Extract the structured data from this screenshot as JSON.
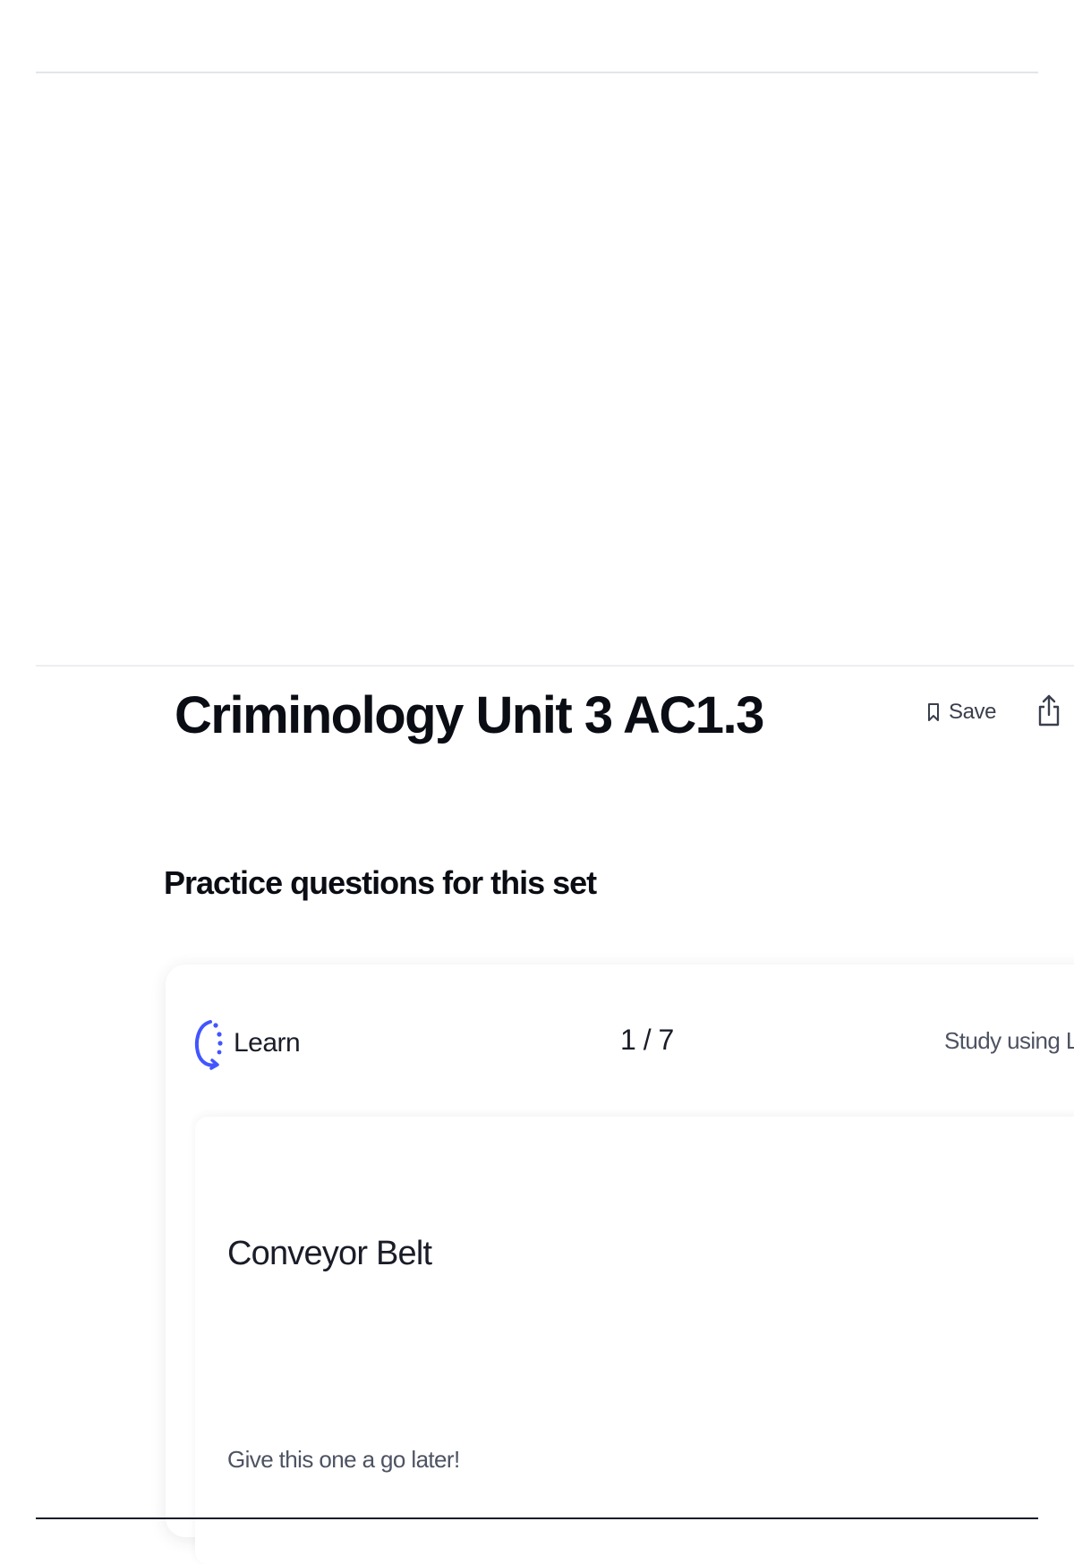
{
  "set": {
    "title": "Criminology Unit 3 AC1.3"
  },
  "toolbar": {
    "save_label": "Save",
    "save_icon": "bookmark-icon",
    "share_icon": "share-icon",
    "more_icon": "more-icon"
  },
  "practice": {
    "heading": "Practice questions for this set",
    "mode_label": "Learn",
    "mode_icon": "learn-icon",
    "progress": "1 / 7",
    "study_link": "Study using Learn",
    "question_term": "Conveyor Belt",
    "skip_label": "Give this one a go later!"
  },
  "colors": {
    "accent": "#4255ff",
    "text_primary": "#0b0d14",
    "text_secondary": "#4e5363",
    "divider": "#e3e5ea"
  }
}
